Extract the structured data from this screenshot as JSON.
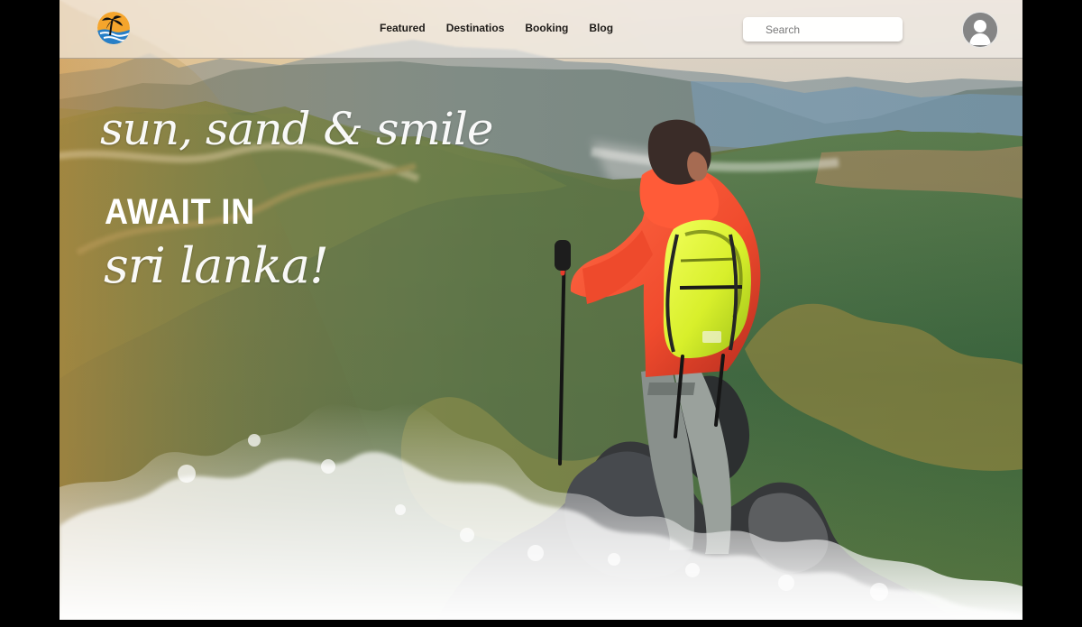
{
  "navigation": {
    "links": [
      "Featured",
      "Destinatios",
      "Booking",
      "Blog"
    ]
  },
  "search": {
    "placeholder": "Search"
  },
  "hero": {
    "line1": "sun, sand & smile",
    "line2": "AWAIT IN",
    "line3": "sri lanka!"
  },
  "icons": {
    "logo": "beach-palm-logo-icon",
    "account": "user-avatar-icon"
  },
  "colors": {
    "page_background": "#000000",
    "navbar": "#f5f2ef",
    "nav_text": "#1e1b18",
    "search_background": "#ffffff",
    "hero_text": "#ffffff",
    "jacket": "#f04b2d",
    "backpack": "#d8ef2b",
    "logo_sun": "#f4a52b",
    "logo_water": "#277fc7",
    "avatar": "#858585"
  }
}
